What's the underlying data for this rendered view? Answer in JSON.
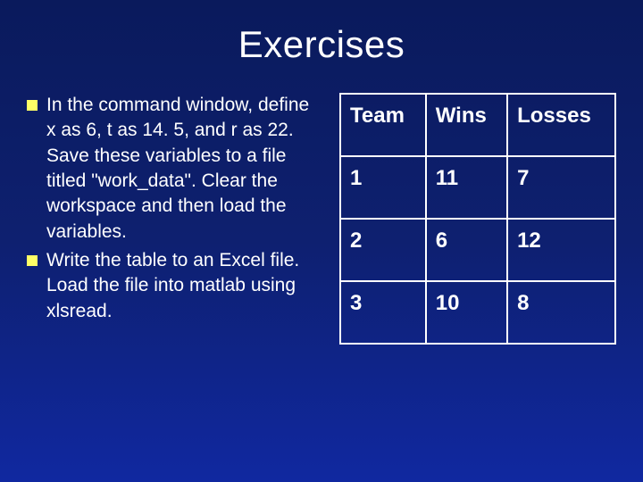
{
  "title": "Exercises",
  "bullets": [
    "In the command window, define x as 6, t as 14. 5, and r as 22. Save these variables to a file titled \"work_data\".  Clear the workspace and then load the variables.",
    "Write the table to an Excel file.  Load the file into matlab using xlsread."
  ],
  "chart_data": {
    "type": "table",
    "headers": [
      "Team",
      "Wins",
      "Losses"
    ],
    "rows": [
      [
        "1",
        "11",
        "7"
      ],
      [
        "2",
        "6",
        "12"
      ],
      [
        "3",
        "10",
        "8"
      ]
    ]
  }
}
